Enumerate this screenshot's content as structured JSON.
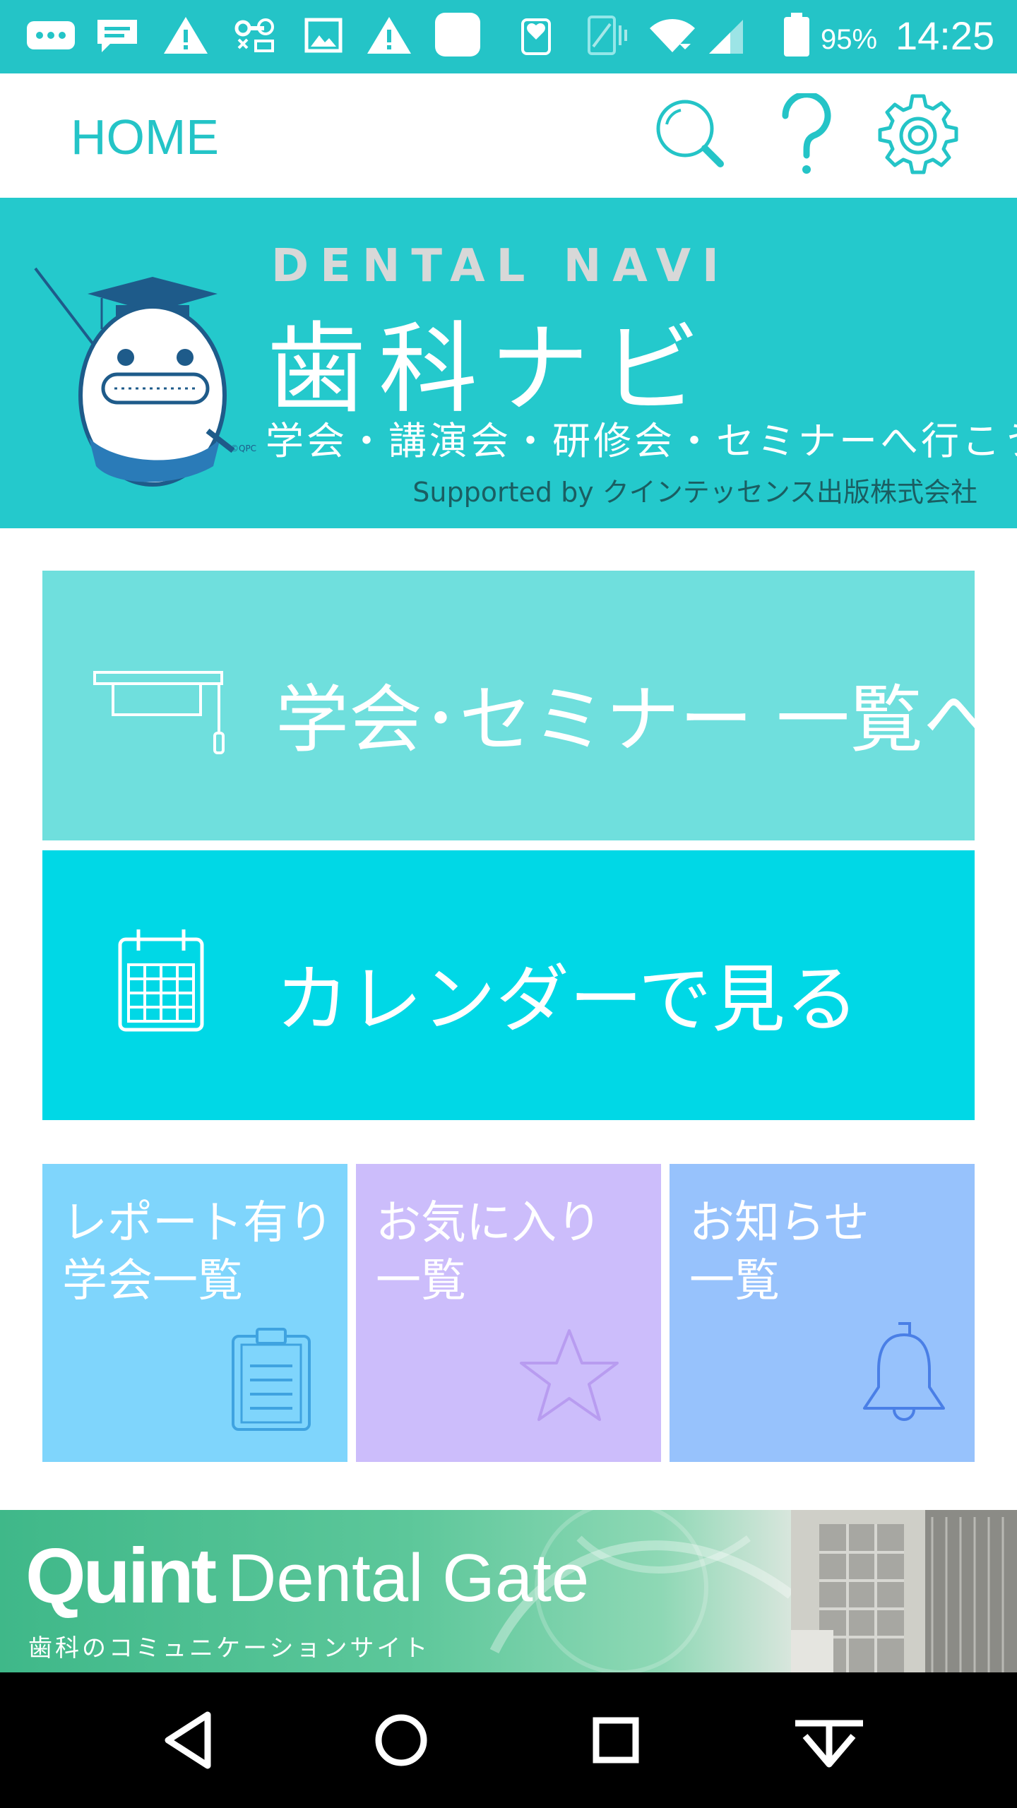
{
  "status_bar": {
    "battery_percent": "95%",
    "time": "14:25",
    "icons": [
      "more-icon",
      "chat-icon",
      "warning-icon",
      "vpn-key-icon",
      "image-icon",
      "warning-icon",
      "square-icon",
      "heart-phone-icon",
      "vibrate-icon",
      "wifi-icon",
      "signal-icon",
      "battery-icon"
    ]
  },
  "app_bar": {
    "title": "HOME",
    "actions": [
      "search-icon",
      "help-icon",
      "settings-icon"
    ]
  },
  "hero": {
    "title_en": "DENTAL NAVI",
    "title_jp": "歯科ナビ",
    "tagline": "学会・講演会・研修会・セミナーへ行こう",
    "supported_by": "Supported by クインテッセンス出版株式会社",
    "mascot_mark": "©QPC"
  },
  "buttons": {
    "list": {
      "label": "学会･セミナー 一覧へ",
      "icon": "mortarboard-icon",
      "color": "#6fdfdd"
    },
    "calendar": {
      "label": "カレンダーで見る",
      "icon": "calendar-icon",
      "color": "#00d8e6"
    }
  },
  "tiles": [
    {
      "line1": "レポート有り",
      "line2": "学会一覧",
      "icon": "clipboard-icon",
      "color": "#7fd5fc"
    },
    {
      "line1": "お気に入り",
      "line2": "一覧",
      "icon": "star-icon",
      "color": "#ccbdfb"
    },
    {
      "line1": "お知らせ",
      "line2": "一覧",
      "icon": "bell-icon",
      "color": "#97c2fc"
    }
  ],
  "banner": {
    "logo_bold": "Quint",
    "logo_light": "Dental Gate",
    "subtitle": "歯科のコミュニケーションサイト"
  },
  "nav_bar": [
    "back-icon",
    "home-icon",
    "recents-icon",
    "download-icon"
  ],
  "colors": {
    "accent": "#24c4c7"
  }
}
